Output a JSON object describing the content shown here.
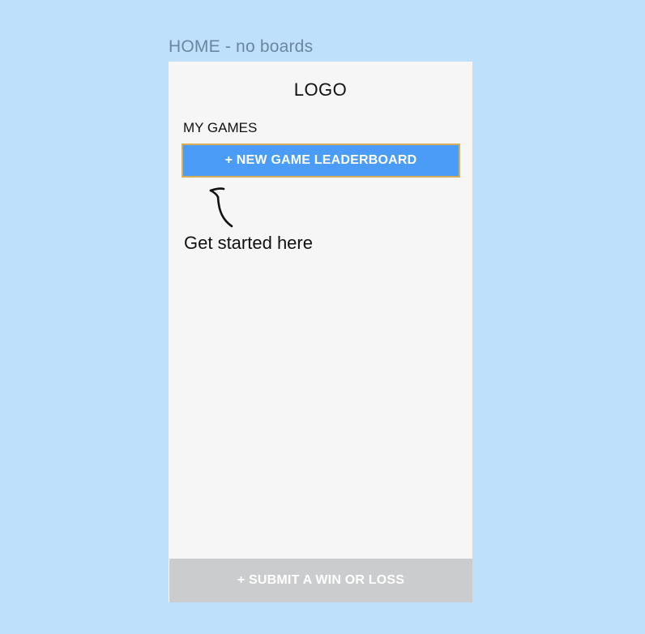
{
  "frame": {
    "label": "HOME - no boards"
  },
  "header": {
    "logo": "LOGO"
  },
  "games": {
    "section_title": "MY GAMES",
    "new_game_button": "+ NEW GAME LEADERBOARD"
  },
  "hint": {
    "text": "Get started here",
    "icon": "curved-arrow-up-icon"
  },
  "footer": {
    "submit_button": "+ SUBMIT A WIN OR LOSS"
  },
  "colors": {
    "canvas": "#bfe0fa",
    "screen": "#f6f6f6",
    "primary_button": "#4a9cf6",
    "primary_button_border": "#d9ad5a",
    "disabled_bar": "#cbcccd"
  }
}
